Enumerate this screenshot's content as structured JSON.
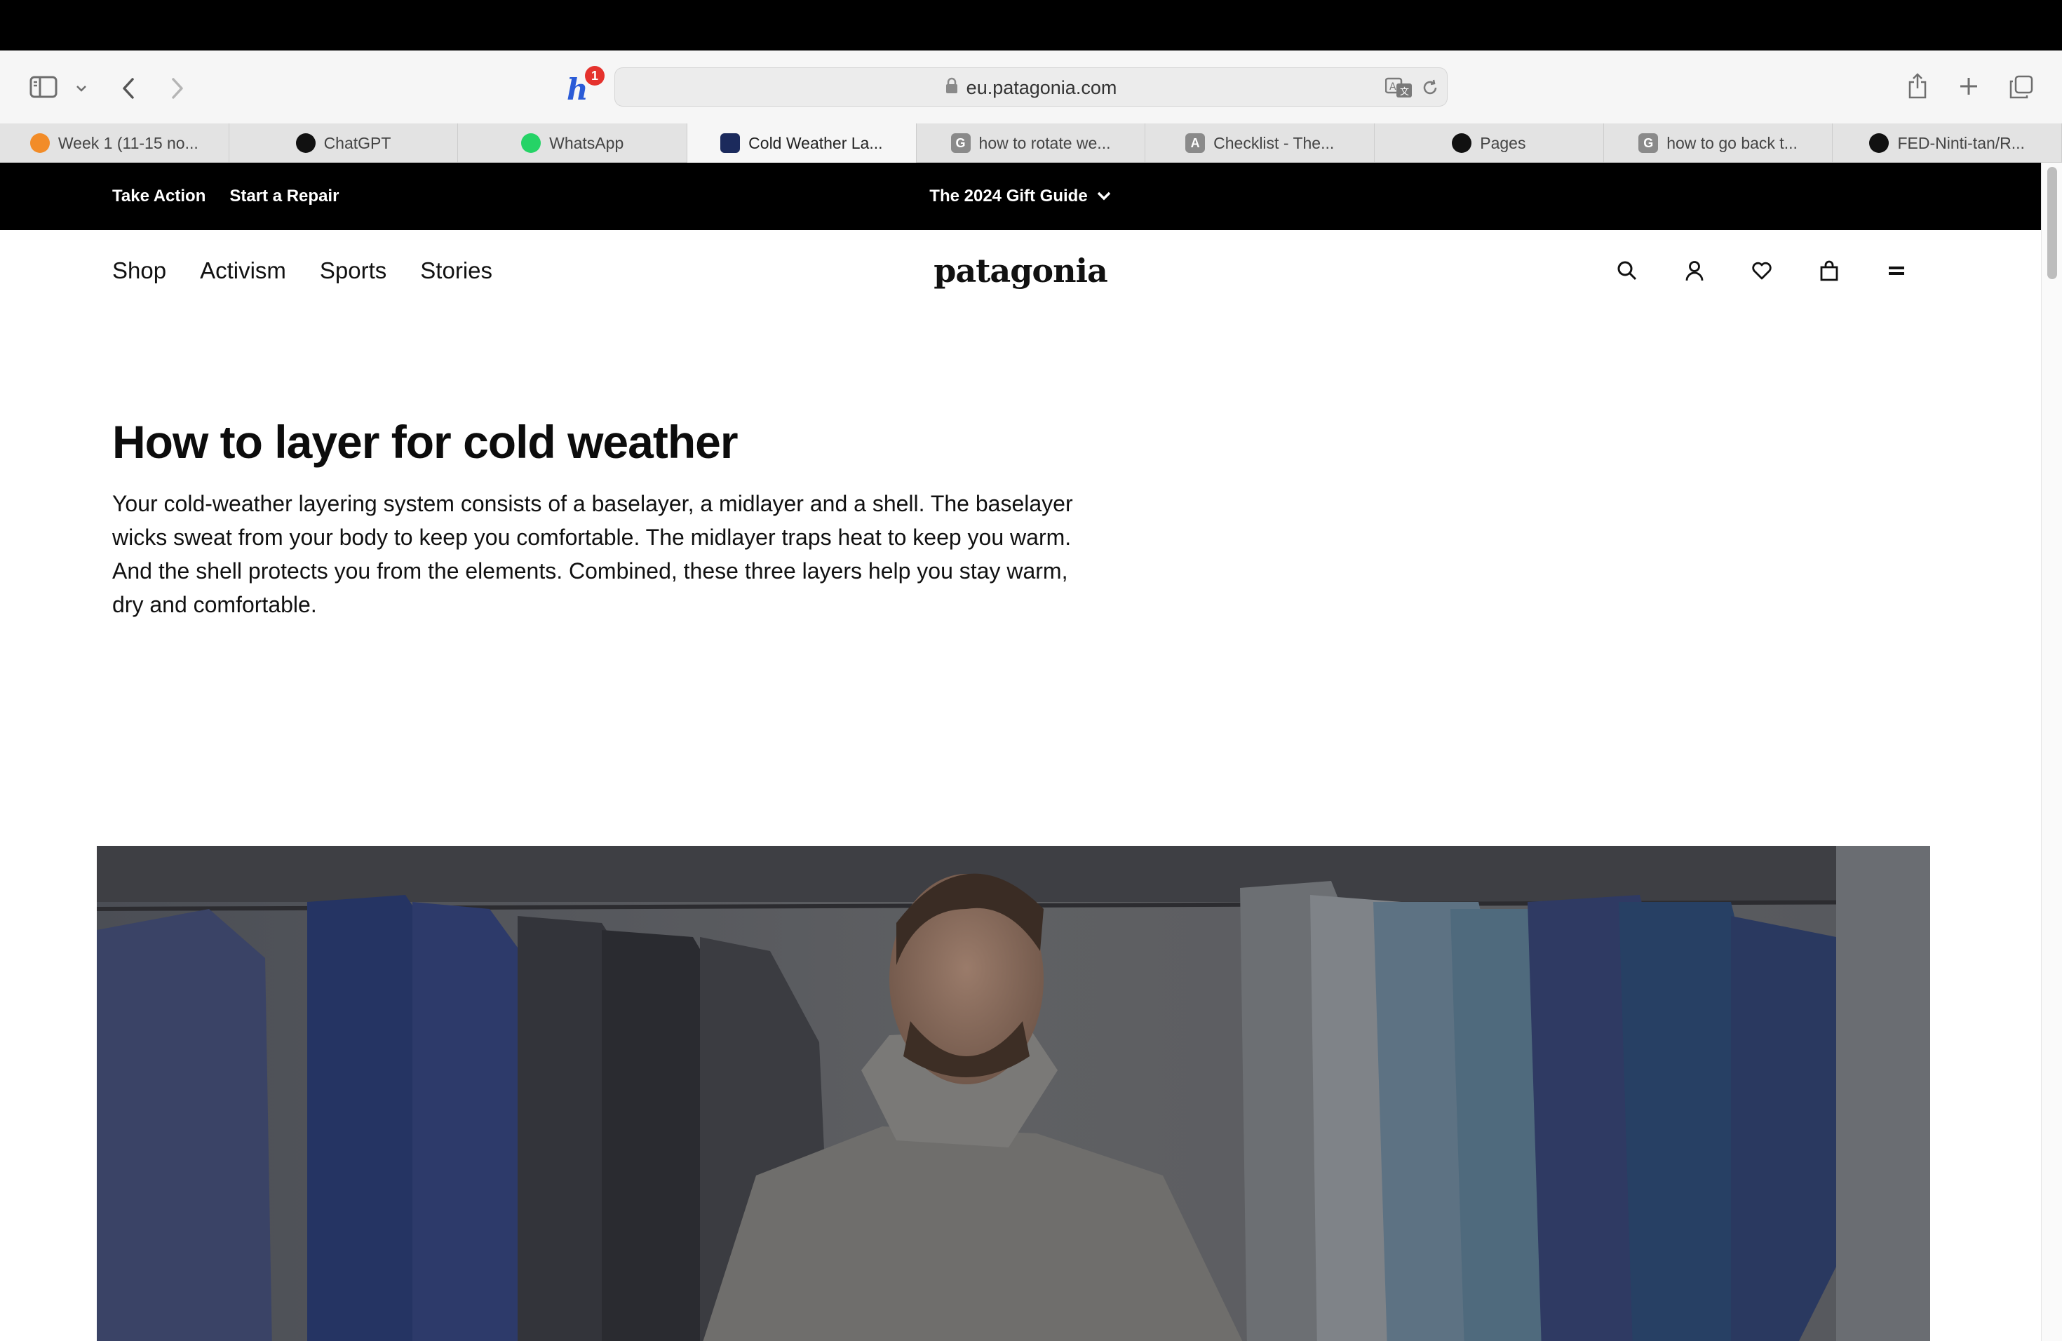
{
  "browser": {
    "url": "eu.patagonia.com",
    "extension_badge": "1",
    "tabs": [
      {
        "label": "Week 1 (11-15 no...",
        "favicon": "orange-circle-icon",
        "color": "#f28c28"
      },
      {
        "label": "ChatGPT",
        "favicon": "chatgpt-icon",
        "color": "#111111"
      },
      {
        "label": "WhatsApp",
        "favicon": "whatsapp-icon",
        "color": "#25d366"
      },
      {
        "label": "Cold Weather La...",
        "favicon": "patagonia-icon",
        "color": "#1b2a5c",
        "active": true
      },
      {
        "label": "how to rotate we...",
        "favicon": "g-icon",
        "letter": "G",
        "color": "#8a8a8a"
      },
      {
        "label": "Checklist - The...",
        "favicon": "a-icon",
        "letter": "A",
        "color": "#8a8a8a"
      },
      {
        "label": "Pages",
        "favicon": "github-icon",
        "color": "#111111"
      },
      {
        "label": "how to go back t...",
        "favicon": "g-icon",
        "letter": "G",
        "color": "#8a8a8a"
      },
      {
        "label": "FED-Ninti-tan/R...",
        "favicon": "github-icon",
        "color": "#111111"
      }
    ]
  },
  "promo_bar": {
    "take_action": "Take Action",
    "start_repair": "Start a Repair",
    "gift_guide": "The 2024 Gift Guide"
  },
  "nav": {
    "links": [
      "Shop",
      "Activism",
      "Sports",
      "Stories"
    ],
    "logo": "patagonia",
    "icons": [
      "search-icon",
      "account-icon",
      "heart-icon",
      "bag-icon",
      "menu-icon"
    ]
  },
  "article": {
    "title": "How to layer for cold weather",
    "lede": "Your cold-weather layering system consists of a baselayer, a midlayer and a shell. The baselayer wicks sweat from your body to keep you comfortable. The midlayer traps heat to keep you warm. And the shell protects you from the elements. Combined, these three layers help you stay warm, dry and comfortable."
  },
  "colors": {
    "promo_background": "#000000",
    "page_background": "#ffffff",
    "extension_badge": "#e5322d"
  }
}
